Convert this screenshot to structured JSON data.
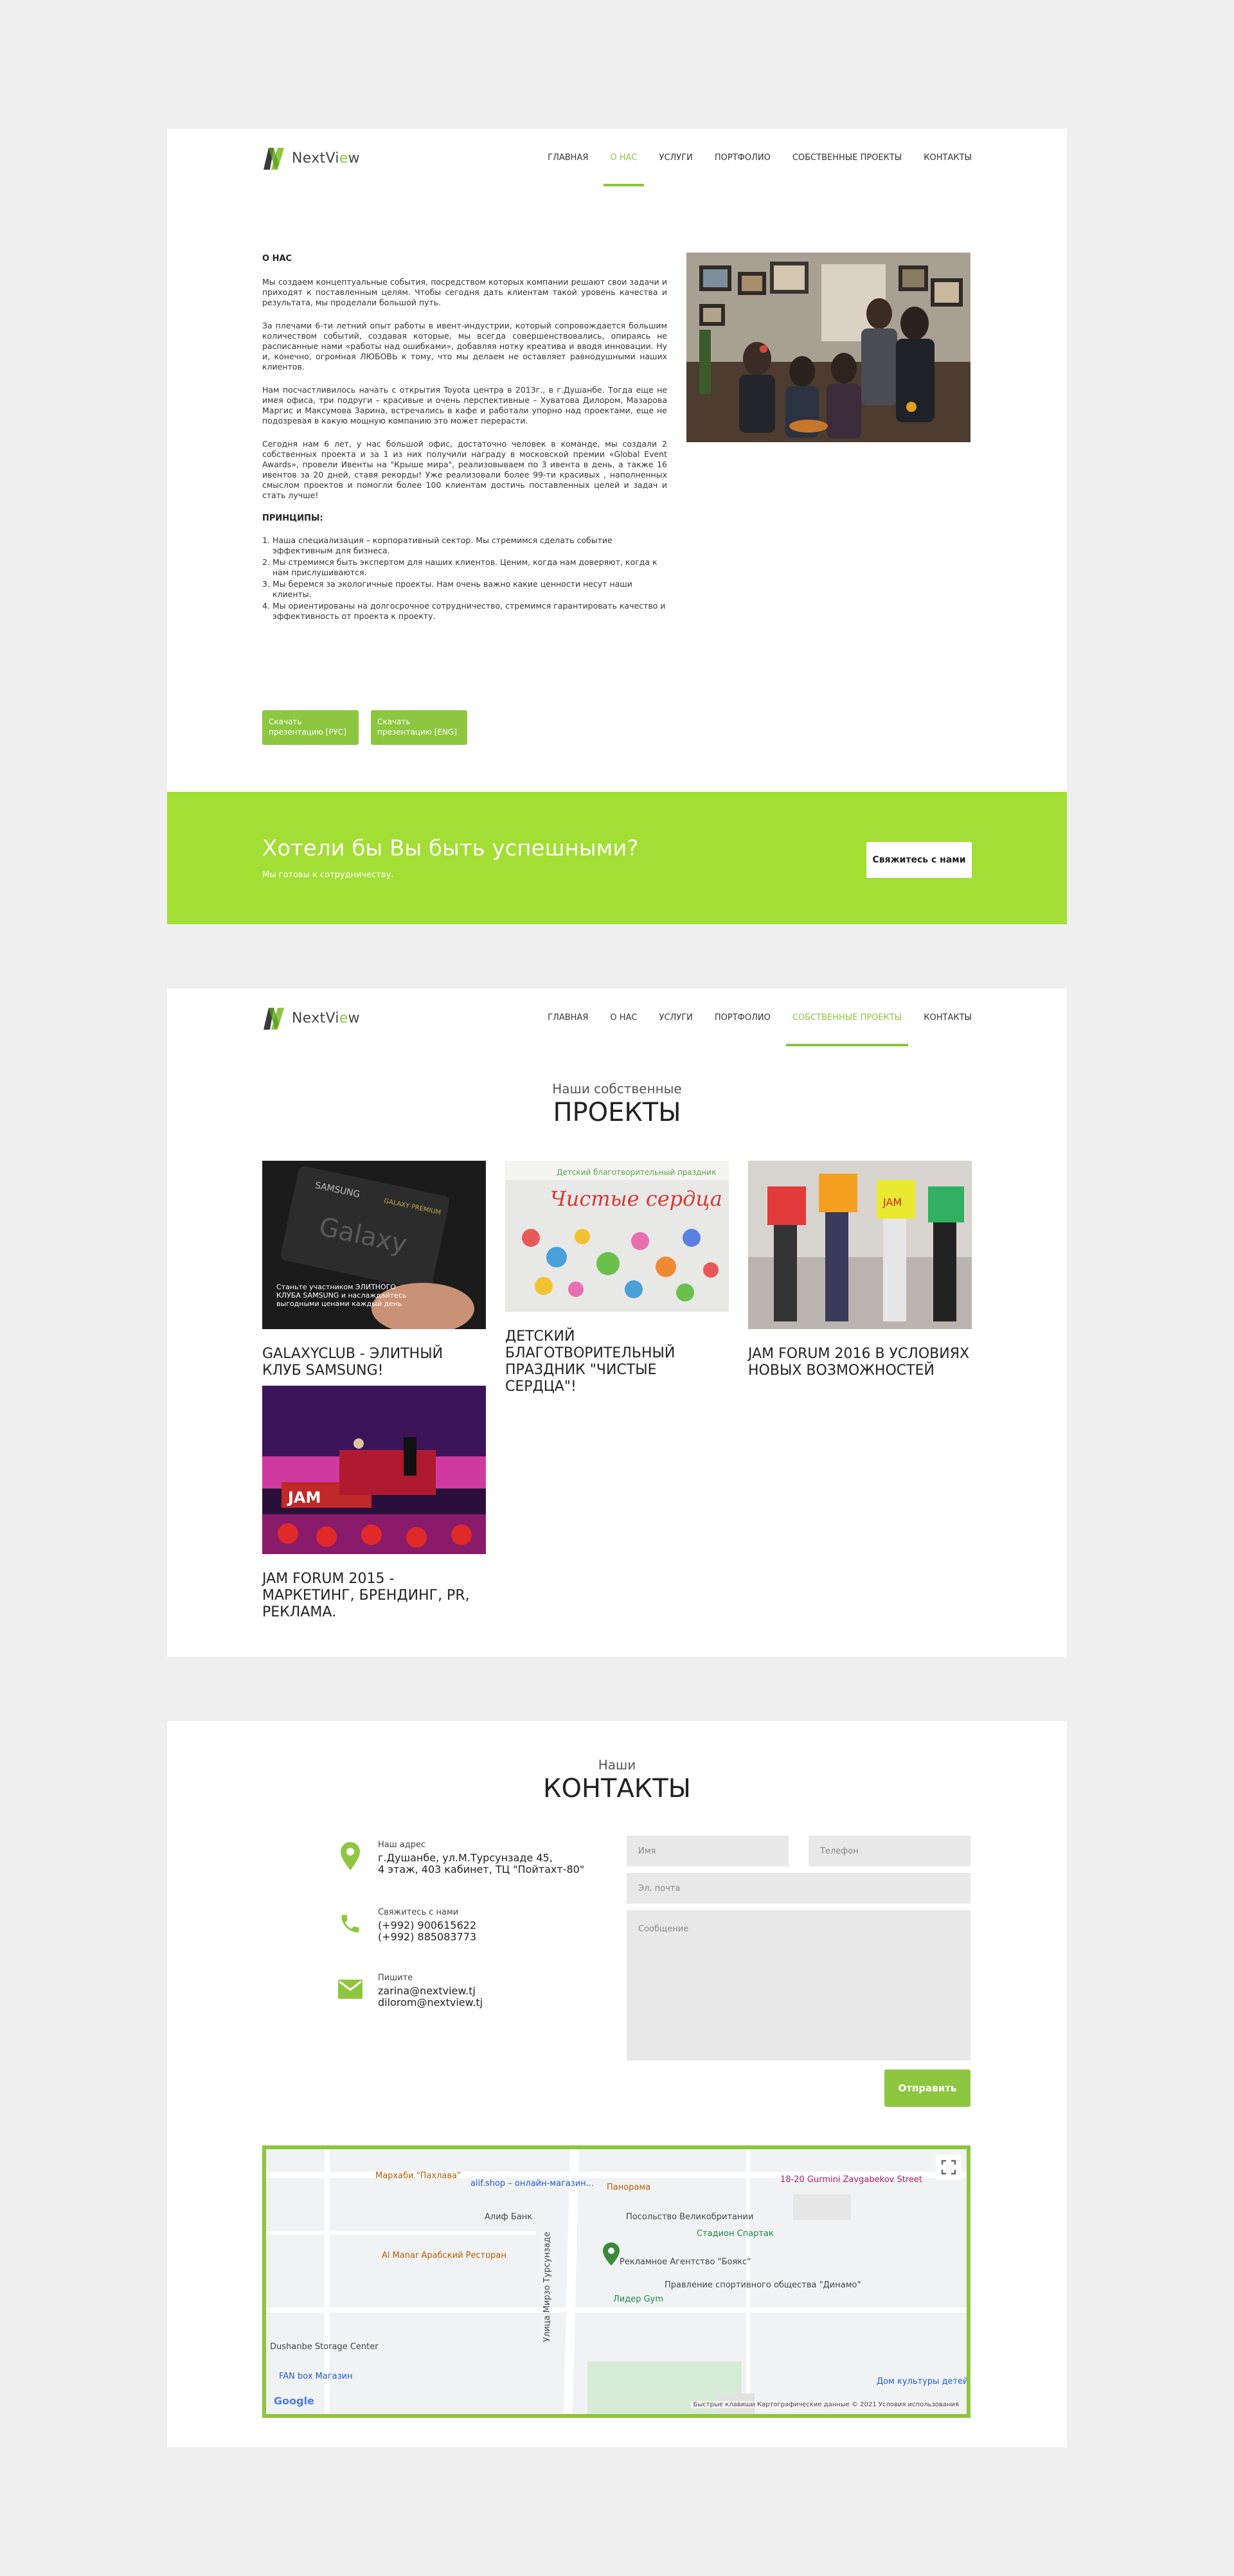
{
  "brand": {
    "name_prefix": "NextVi",
    "name_v": "e",
    "name_suffix": "w",
    "accent": "#8dc63f",
    "banner_bg": "#a2de33"
  },
  "nav": {
    "items": [
      "ГЛАВНАЯ",
      "О НАС",
      "УСЛУГИ",
      "ПОРТФОЛИО",
      "СОБСТВЕННЫЕ ПРОЕКТЫ",
      "КОНТАКТЫ"
    ]
  },
  "about": {
    "heading": "О НАС",
    "p1": "Мы создаем концептуальные события, посредством которых компании решают свои задачи и приходят к поставленным целям. Чтобы сегодня дать клиентам такой уровень качества и результата, мы проделали большой путь.",
    "p2": "За плечами 6-ти летний опыт работы в ивент-индустрии, который сопровождается большим количеством событий, создавая которые, мы всегда совершенствовались, опираясь не расписанные нами «работы над ошибками», добавляя нотку креатива и вводя инновации. Ну и, конечно, огромная ЛЮБОВЬ к тому, что мы делаем не оставляет равнодушными наших клиентов.",
    "p3": "Нам посчастливилось начать с открытия Toyota центра в 2013г., в г.Душанбе. Тогда еще не имея офиса, три подруги – красивые и очень перспективные – Хуватова Дилором, Мазарова Маргис и Максумова Зарина, встречались в кафе и работали упорно над проектами, еще не подозревая в какую мощную компанию это может перерасти.",
    "p4": "Сегодня нам 6 лет, у нас большой офис, достаточно человек в команде, мы создали 2 собственных проекта и за 1 из них получили награду в московской премии «Global Event Awards», провели Ивенты на \"Крыше мира\", реализовываем по 3 ивента в день, а также 16 ивентов за 20 дней, ставя рекорды! Уже реализовали более 99-ти красивых , наполненных смыслом проектов и помогли более 100 клиентам достичь поставленных целей и задач и стать лучше!",
    "principles_heading": "ПРИНЦИПЫ:",
    "principles": [
      "Наша специализация – корпоративный сектор. Мы стремимся сделать событие эффективным для бизнеса.",
      "Мы стремимся быть экспертом для наших клиентов. Ценим, когда нам доверяют, когда к нам прислушиваются.",
      "Мы беремся за экологичные проекты. Нам очень важно какие ценности несут наши клиенты.",
      "Мы ориентированы на долгосрочное сотрудничество, стремимся гарантировать качество и эффективность от проекта к проекту."
    ],
    "download_ru": "Скачать презентацию [РУС]",
    "download_en": "Скачать презентацию [ENG]"
  },
  "banner": {
    "title": "Хотели бы Вы быть успешными?",
    "subtitle": "Мы готовы к сотрудничеству.",
    "button": "Свяжитесь с нами"
  },
  "projects": {
    "pre": "Наши собственные",
    "title": "ПРОЕКТЫ",
    "items": [
      {
        "title": "GALAXYCLUB - ЭЛИТНЫЙ КЛУБ SAMSUNG!",
        "img_text1": "SAMSUNG",
        "img_text2": "GALAXY PREMIUM",
        "img_text3": "Станьте участником ЭЛИТНОГО КЛУБА SAMSUNG и наслаждайтесь выгодными ценами каждый день"
      },
      {
        "title": "ДЕТСКИЙ БЛАГОТВОРИТЕЛЬНЫЙ ПРАЗДНИК \"ЧИСТЫЕ СЕРДЦА\"!",
        "img_text1": "Детский благотворительный праздник",
        "img_text2": "Чистые сердца"
      },
      {
        "title": "JAM FORUM 2016 В УСЛОВИЯХ НОВЫХ ВОЗМОЖНОСТЕЙ",
        "img_text1": "JAM"
      },
      {
        "title": "JAM FORUM 2015 - МАРКЕТИНГ, БРЕНДИНГ, PR, РЕКЛАМА.",
        "img_text1": "JAM"
      }
    ]
  },
  "contacts": {
    "pre": "Наши",
    "title": "КОНТАКТЫ",
    "address_label": "Наш адрес",
    "address_lines": [
      "г.Душанбе, ул.М.Турсунзаде 45,",
      "4 этаж, 403 кабинет, ТЦ \"Пойтахт-80\""
    ],
    "phone_label": "Свяжитесь с нами",
    "phones": [
      "(+992) 900615622",
      "(+992) 885083773"
    ],
    "email_label": "Пишите",
    "emails": [
      "zarina@nextview.tj",
      "dilorom@nextview.tj"
    ],
    "form": {
      "name_placeholder": "Имя",
      "phone_placeholder": "Телефон",
      "email_placeholder": "Эл. почта",
      "message_placeholder": "Сообщение",
      "submit": "Отправить"
    }
  },
  "map": {
    "labels": {
      "mansion": "Мархаби \"Пахлава\"",
      "panorama": "Панорама",
      "alif_shop": "alif.shop – онлайн-магазин...",
      "alif_bank": "Алиф Банк",
      "embassy": "Посольство Великобритании",
      "stadium": "Стадион Спартак",
      "restaurant": "Al Manar Арабский Ресторан",
      "agency": "Рекламное Агентство \"Боякс\"",
      "gym": "Лидер Gym",
      "dinamo": "Правление спортивного общества \"Динамо\"",
      "gurmini": "18-20 Gurmini Zavgabekov Street",
      "culture": "Дом культуры детей и подростков",
      "street": "Улица Мирзо Турсунзаде",
      "storage": "Dushanbe Storage Center",
      "fan": "FAN box Магазин",
      "google": "Google",
      "footer": "Быстрые клавиши   Картографические данные © 2021   Условия использования"
    }
  }
}
